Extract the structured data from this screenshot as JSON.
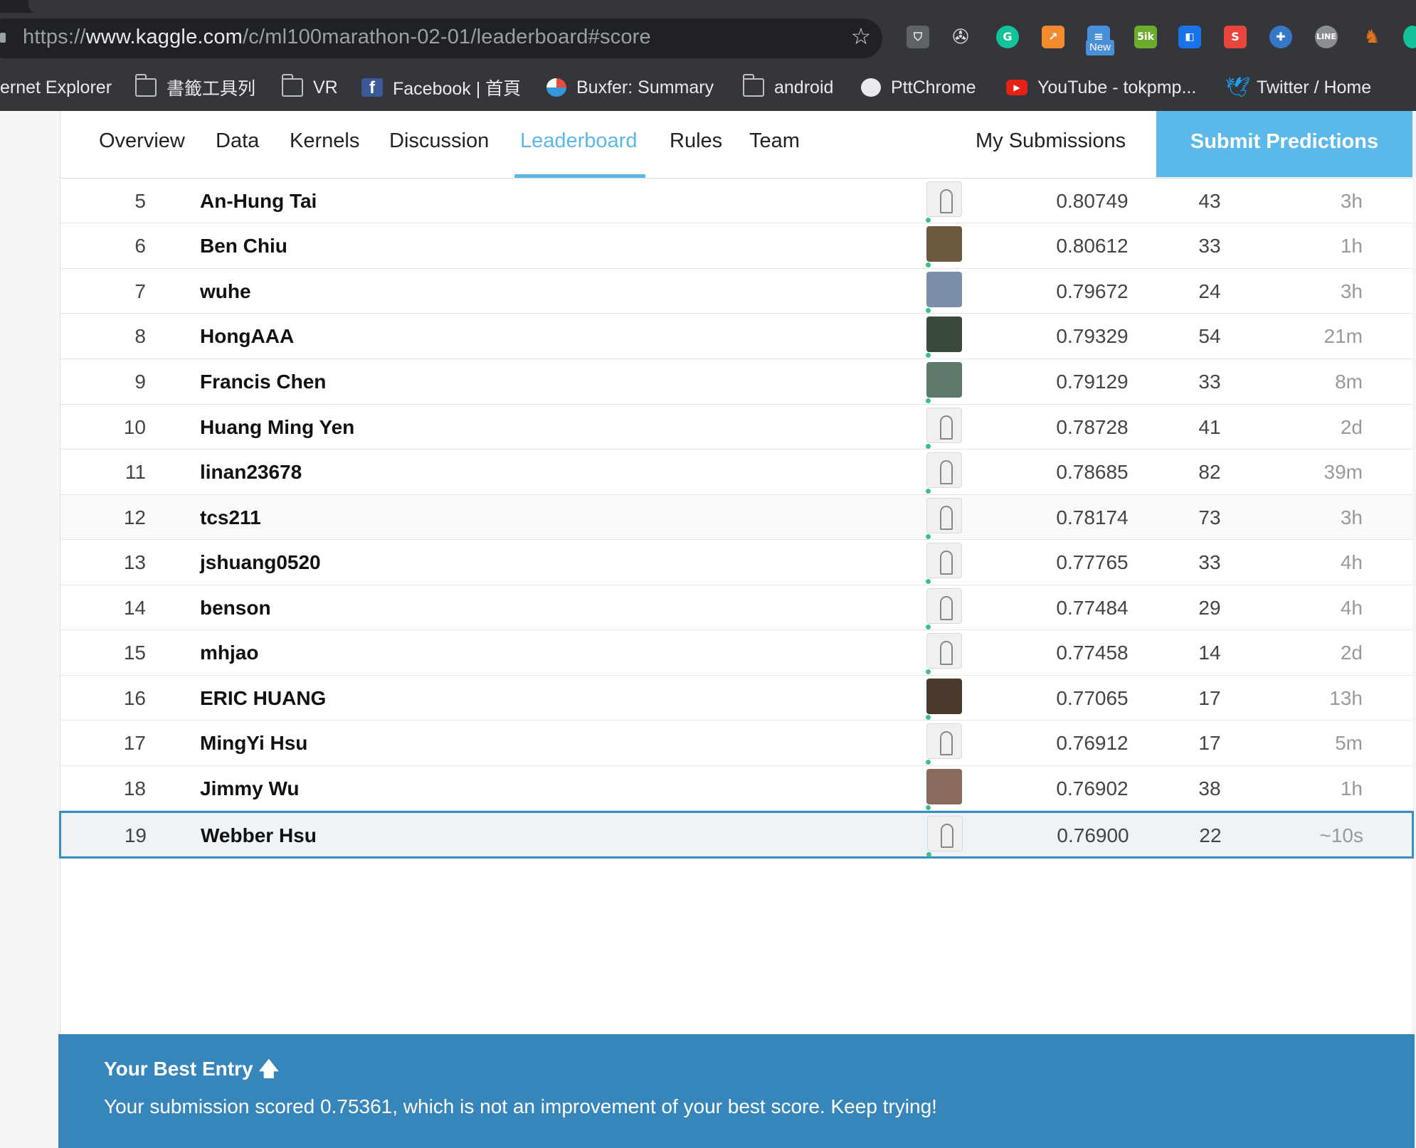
{
  "browser": {
    "url_scheme": "https://",
    "url_host": "www.kaggle.com",
    "url_path": "/c/ml100marathon-02-01/leaderboard#score",
    "extension_badge": "New",
    "bookmarks": [
      {
        "label": "ernet Explorer",
        "icon": "none"
      },
      {
        "label": "書籤工具列",
        "icon": "folder-icon"
      },
      {
        "label": "VR",
        "icon": "folder-icon"
      },
      {
        "label": "Facebook | 首頁",
        "icon": "facebook-icon"
      },
      {
        "label": "Buxfer: Summary",
        "icon": "buxfer-icon"
      },
      {
        "label": "android",
        "icon": "folder-icon"
      },
      {
        "label": "PttChrome",
        "icon": "globe-icon"
      },
      {
        "label": "YouTube - tokpmp...",
        "icon": "youtube-icon"
      },
      {
        "label": "Twitter / Home",
        "icon": "twitter-icon"
      }
    ]
  },
  "nav": {
    "tabs": [
      "Overview",
      "Data",
      "Kernels",
      "Discussion",
      "Leaderboard",
      "Rules",
      "Team"
    ],
    "active_tab": "Leaderboard",
    "my_submissions": "My Submissions",
    "submit": "Submit Predictions"
  },
  "leaderboard": {
    "rows": [
      {
        "rank": "5",
        "team": "An-Hung Tai",
        "avatar": "goose",
        "score": "0.80749",
        "entries": "43",
        "last": "3h"
      },
      {
        "rank": "6",
        "team": "Ben Chiu",
        "avatar": "photo",
        "score": "0.80612",
        "entries": "33",
        "last": "1h"
      },
      {
        "rank": "7",
        "team": "wuhe",
        "avatar": "photo",
        "score": "0.79672",
        "entries": "24",
        "last": "3h"
      },
      {
        "rank": "8",
        "team": "HongAAA",
        "avatar": "photo",
        "score": "0.79329",
        "entries": "54",
        "last": "21m"
      },
      {
        "rank": "9",
        "team": "Francis Chen",
        "avatar": "photo",
        "score": "0.79129",
        "entries": "33",
        "last": "8m"
      },
      {
        "rank": "10",
        "team": "Huang Ming Yen",
        "avatar": "goose",
        "score": "0.78728",
        "entries": "41",
        "last": "2d"
      },
      {
        "rank": "11",
        "team": "linan23678",
        "avatar": "goose",
        "score": "0.78685",
        "entries": "82",
        "last": "39m"
      },
      {
        "rank": "12",
        "team": "tcs211",
        "avatar": "goose",
        "score": "0.78174",
        "entries": "73",
        "last": "3h"
      },
      {
        "rank": "13",
        "team": "jshuang0520",
        "avatar": "goose",
        "score": "0.77765",
        "entries": "33",
        "last": "4h"
      },
      {
        "rank": "14",
        "team": "benson",
        "avatar": "goose",
        "score": "0.77484",
        "entries": "29",
        "last": "4h"
      },
      {
        "rank": "15",
        "team": "mhjao",
        "avatar": "goose",
        "score": "0.77458",
        "entries": "14",
        "last": "2d"
      },
      {
        "rank": "16",
        "team": "ERIC HUANG",
        "avatar": "photo",
        "score": "0.77065",
        "entries": "17",
        "last": "13h"
      },
      {
        "rank": "17",
        "team": "MingYi Hsu",
        "avatar": "goose",
        "score": "0.76912",
        "entries": "17",
        "last": "5m"
      },
      {
        "rank": "18",
        "team": "Jimmy Wu",
        "avatar": "photo",
        "score": "0.76902",
        "entries": "38",
        "last": "1h"
      },
      {
        "rank": "19",
        "team": "Webber Hsu",
        "avatar": "goose",
        "score": "0.76900",
        "entries": "22",
        "last": "~10s",
        "highlight": true
      }
    ]
  },
  "banner": {
    "title": "Your Best Entry",
    "title_icon": "arrow-up-icon",
    "message": "Your submission scored 0.75361, which is not an improvement of your best score. Keep trying!"
  },
  "colors": {
    "accent": "#5ab8e8",
    "banner": "#3786bb",
    "online": "#3dc08a"
  }
}
